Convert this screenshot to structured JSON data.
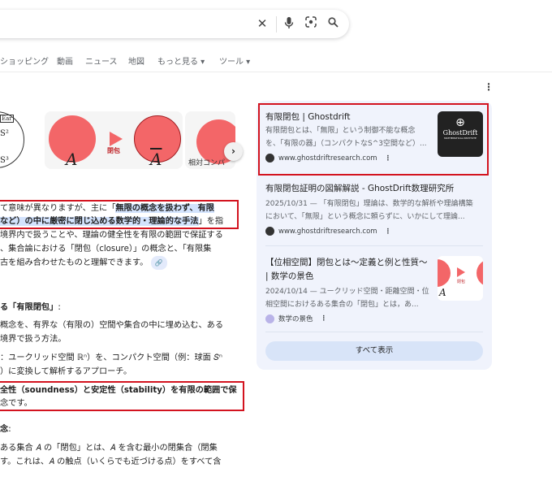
{
  "search": {
    "clear_icon": "close-icon",
    "mic_icon": "mic-icon",
    "lens_icon": "lens-icon",
    "search_icon": "search-icon"
  },
  "tabs": [
    "ショッピング",
    "動画",
    "ニュース",
    "地図",
    "もっと見る ▾",
    "ツール ▾"
  ],
  "images": {
    "closure_label": "閉包",
    "a_label": "A",
    "abar_label": "A",
    "third_caption": "相対コンパ",
    "first_labels": [
      "Ear",
      "S²",
      "S³"
    ]
  },
  "answer": {
    "p1": [
      "て意味が異なりますが、主に「",
      "無限の概念を扱わず、有限",
      "など）の中に厳密に閉じ込める数学的・理論的な手法",
      "」を指",
      "境界内で扱うことや、理論の健全性を有限の範囲で保証する",
      "、集合論における「閉包（closure）」の概念と、「有限集",
      "古を組み合わせたものと理解できます。"
    ],
    "h1": "る「有限閉包」",
    "h1_colon": ":",
    "p2": [
      "概念を、有界な（有限の）空間や集合の中に埋め込む、ある",
      "境界で扱う方法。"
    ],
    "p3": [
      "：ユークリッド空間 ℝⁿ）を、コンパクト空間（例：球面 𝑆ⁿ",
      "）に変換して解析するアプローチ。"
    ],
    "p4": [
      "全性（soundness）と安定性（stability）を有限の範囲で保",
      "念です。"
    ],
    "h2": "念",
    "h2_colon": ":",
    "p5": [
      "ある集合 𝐴 の「閉包」とは、𝐴 を含む最小の閉集合（閉集",
      "す。これは、𝐴 の触点（いくらでも近づける点）をすべて含"
    ]
  },
  "sources": [
    {
      "title": "有限閉包 | Ghostdrift",
      "snippet": [
        "有限閉包とは、「無限」という制御不能な概念",
        "を、「有限の器」（コンパクトなS^3空間など）..."
      ],
      "site": "www.ghostdriftresearch.com",
      "thumb_title": "GhostDrift",
      "thumb_sub": "MATHEMATICAL INSTITUTE"
    },
    {
      "title": "有限閉包証明の図解解説 - GhostDrift数理研究所",
      "snippet": [
        "2025/10/31 — 「有限閉包」理論は、数学的な解析や理論構築",
        "において、「無限」という概念に頼らずに、いかにして理論..."
      ],
      "site": "www.ghostdriftresearch.com"
    },
    {
      "title": [
        "【位相空間】閉包とは〜定義と例と性質〜",
        "| 数学の景色"
      ],
      "snippet": [
        "2024/10/14 — ユークリッド空間・距離空間・位",
        "相空間におけるある集合の「閉包」とは，あ..."
      ],
      "site": "数学の景色",
      "thumb_label": "閉包",
      "thumb_a": "A"
    }
  ],
  "show_all": "すべて表示",
  "colors": {
    "accent_red": "#d3131f",
    "highlight": "#d3e3fd",
    "panel": "#f0f3fc"
  }
}
